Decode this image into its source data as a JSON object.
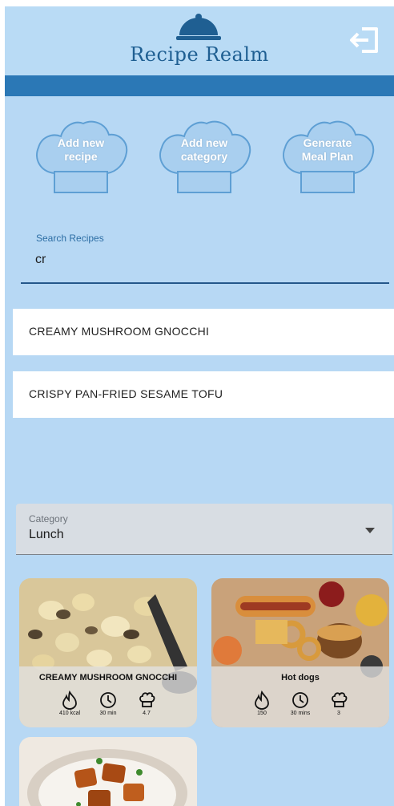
{
  "header": {
    "title": "Recipe Realm",
    "logo_icon": "cloche-icon",
    "logout_icon": "logout-icon",
    "colors": {
      "header": "#b9dbf5",
      "band": "#2b78b6",
      "background": "#b7d8f4",
      "accent": "#2e80c4"
    }
  },
  "actions": [
    {
      "line1": "Add new",
      "line2": "recipe"
    },
    {
      "line1": "Add new",
      "line2": "category"
    },
    {
      "line1": "Generate",
      "line2": "Meal Plan"
    }
  ],
  "search": {
    "label": "Search Recipes",
    "value": "cr"
  },
  "results": [
    "CREAMY MUSHROOM GNOCCHI",
    "CRISPY PAN-FRIED SESAME TOFU"
  ],
  "category": {
    "label": "Category",
    "value": "Lunch"
  },
  "cards": [
    {
      "title": "CREAMY MUSHROOM GNOCCHI",
      "calories": "410 kcal",
      "time": "30 min",
      "rating": "4.7"
    },
    {
      "title": "Hot dogs",
      "calories": "150",
      "time": "30 mins",
      "rating": "3"
    },
    {
      "title": "",
      "calories": "",
      "time": "",
      "rating": ""
    }
  ]
}
